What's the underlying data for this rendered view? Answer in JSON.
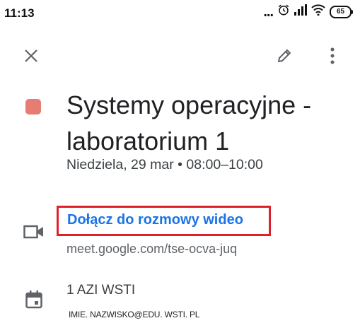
{
  "status_bar": {
    "time": "11:13",
    "more_dots": "...",
    "battery": "65"
  },
  "toolbar": {
    "close_icon": "close-icon",
    "edit_icon": "pencil-icon",
    "more_icon": "more-vert-icon"
  },
  "event": {
    "color": "#e67c73",
    "title": "Systemy operacyjne - laboratorium 1",
    "datetime": "Niedziela, 29 mar  •  08:00–10:00",
    "video": {
      "icon": "video-camera-icon",
      "join_label": "Dołącz do rozmowy wideo",
      "url": "meet.google.com/tse-ocva-juq",
      "highlight_color": "#e0212b"
    },
    "calendar": {
      "icon": "calendar-icon",
      "name": "1 AZI WSTI",
      "owner": "IMIE. NAZWISKO@EDU. WSTI. PL"
    }
  }
}
